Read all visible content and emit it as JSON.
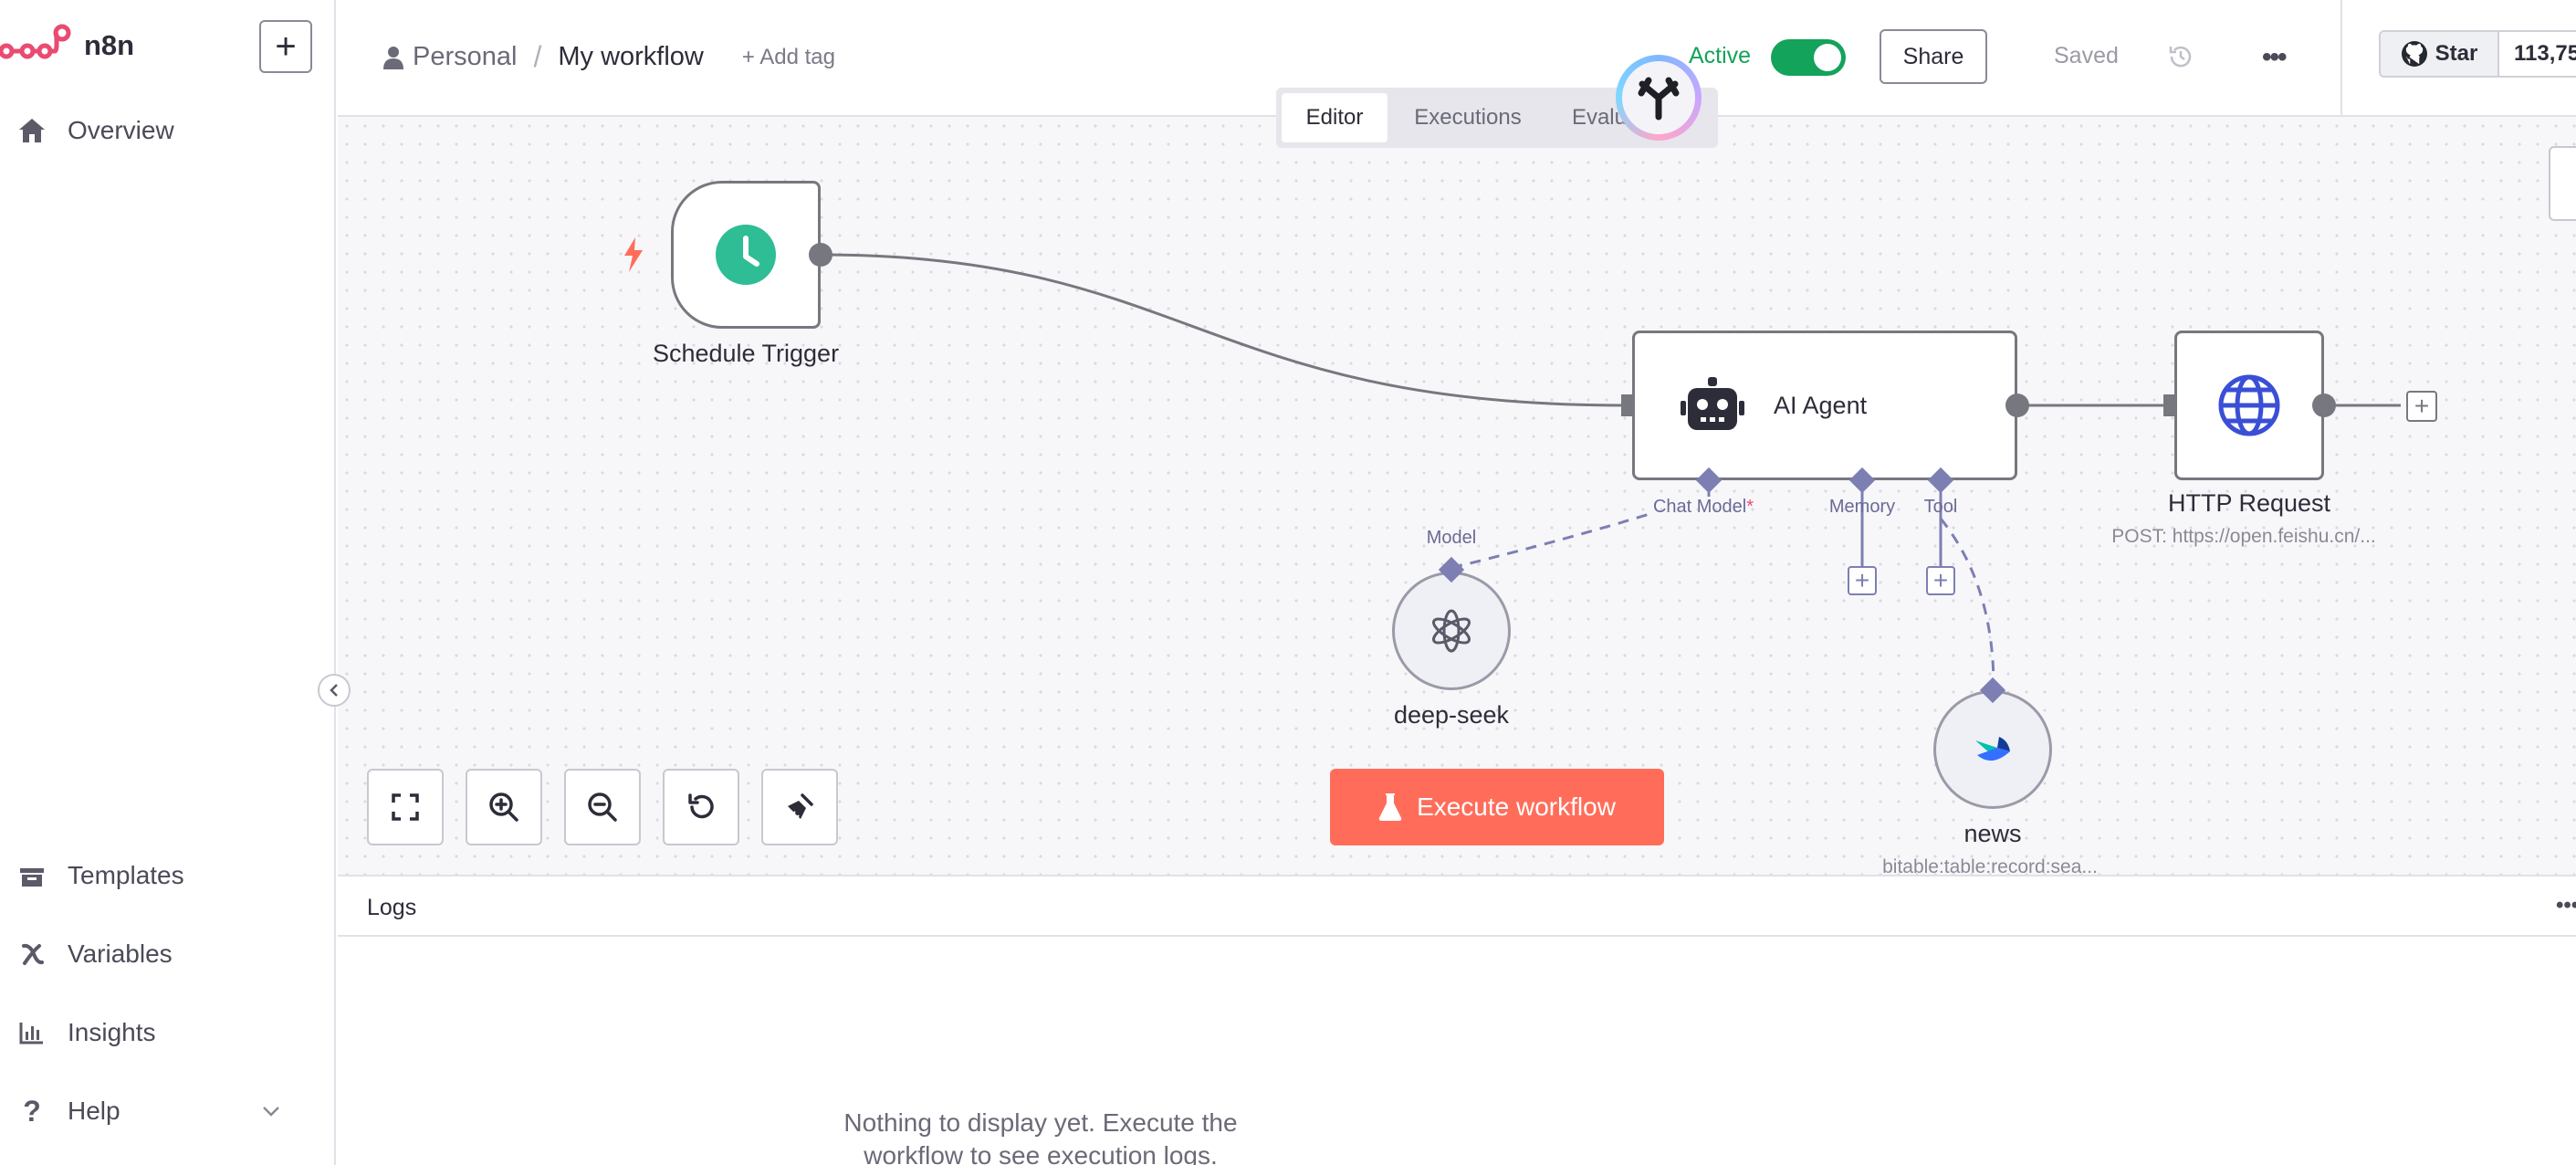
{
  "app": {
    "name": "n8n"
  },
  "sidebar": {
    "overview": "Overview",
    "bottom_items": [
      {
        "label": "Templates",
        "icon": "templates-icon"
      },
      {
        "label": "Variables",
        "icon": "variables-icon"
      },
      {
        "label": "Insights",
        "icon": "insights-icon"
      },
      {
        "label": "Help",
        "icon": "help-icon"
      }
    ]
  },
  "header": {
    "breadcrumb_project": "Personal",
    "breadcrumb_separator": "/",
    "workflow_name": "My workflow",
    "add_tag": "+ Add tag",
    "active_label": "Active",
    "active_state": true,
    "share": "Share",
    "saved": "Saved",
    "github_star": "Star",
    "github_count": "113,75"
  },
  "tabs": [
    {
      "label": "Editor",
      "selected": true
    },
    {
      "label": "Executions",
      "selected": false
    },
    {
      "label": "Evaluations",
      "selected": false
    }
  ],
  "nodes": {
    "schedule_trigger": {
      "label": "Schedule Trigger"
    },
    "ai_agent": {
      "label": "AI Agent",
      "ports": {
        "chat_model": "Chat Model",
        "required_mark": "*",
        "memory": "Memory",
        "tool": "Tool"
      }
    },
    "http_request": {
      "label": "HTTP Request",
      "subtitle": "POST: https://open.feishu.cn/..."
    },
    "deep_seek": {
      "label": "deep-seek",
      "port": "Model"
    },
    "news": {
      "label": "news",
      "subtitle": "bitable:table:record:sea..."
    }
  },
  "execute_button": "Execute workflow",
  "logs": {
    "title": "Logs",
    "empty_line1": "Nothing to display yet. Execute the",
    "empty_line2": "workflow to see execution logs."
  },
  "colors": {
    "brand": "#ea4b71",
    "execute": "#ff6d5a",
    "toggle": "#13a35a",
    "trigger": "#2ebd94",
    "port": "#7d7fb2",
    "http": "#3a4fd6"
  }
}
